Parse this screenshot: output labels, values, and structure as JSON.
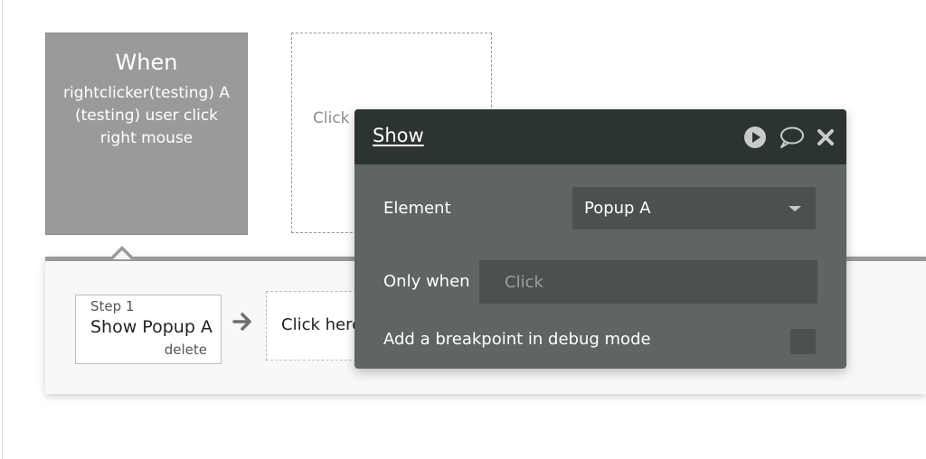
{
  "event": {
    "title": "When",
    "description": "rightclicker(testing) A (testing) user click right mouse"
  },
  "add_event": {
    "label": "Click"
  },
  "step": {
    "label": "Step 1",
    "title": "Show Popup A",
    "delete_label": "delete"
  },
  "add_action": {
    "label": "Click here"
  },
  "panel": {
    "title": "Show",
    "element_label": "Element",
    "element_value": "Popup A",
    "only_when_label": "Only when",
    "only_when_placeholder": "Click",
    "breakpoint_label": "Add a breakpoint in debug mode",
    "breakpoint_checked": false
  },
  "colors": {
    "panel_bg": "#5f6565",
    "panel_header_bg": "#2c3333",
    "event_card_bg": "#9a9a9a"
  }
}
